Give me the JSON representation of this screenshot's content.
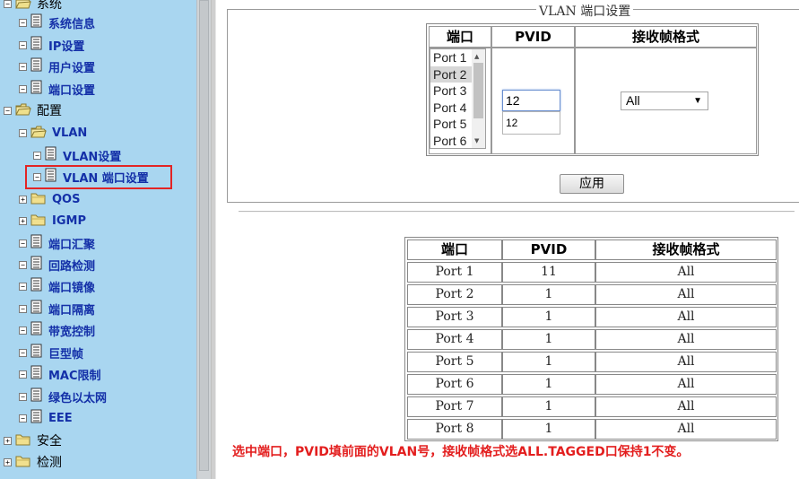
{
  "tree": {
    "items": [
      {
        "label": "系统",
        "level": 1,
        "toggle": "⊟",
        "icon": "open-folder-icon"
      },
      {
        "label": "系统信息",
        "level": 2,
        "toggle": "⊟",
        "icon": "document-icon"
      },
      {
        "label": "IP设置",
        "level": 2,
        "toggle": "⊟",
        "icon": "document-icon"
      },
      {
        "label": "用户设置",
        "level": 2,
        "toggle": "⊟",
        "icon": "document-icon"
      },
      {
        "label": "端口设置",
        "level": 2,
        "toggle": "⊟",
        "icon": "document-icon"
      },
      {
        "label": "配置",
        "level": 1,
        "toggle": "⊟",
        "icon": "open-folder-icon"
      },
      {
        "label": "VLAN",
        "level": 2,
        "toggle": "⊟",
        "icon": "open-folder-icon"
      },
      {
        "label": "VLAN设置",
        "level": 3,
        "toggle": "⊟",
        "icon": "document-icon"
      },
      {
        "label": "VLAN 端口设置",
        "level": 3,
        "toggle": "⊟",
        "icon": "document-icon",
        "selected": true
      },
      {
        "label": "QOS",
        "level": 2,
        "toggle": "⊞",
        "icon": "closed-folder-icon"
      },
      {
        "label": "IGMP",
        "level": 2,
        "toggle": "⊞",
        "icon": "closed-folder-icon"
      },
      {
        "label": "端口汇聚",
        "level": 2,
        "toggle": "⊟",
        "icon": "document-icon"
      },
      {
        "label": "回路检测",
        "level": 2,
        "toggle": "⊟",
        "icon": "document-icon"
      },
      {
        "label": "端口镜像",
        "level": 2,
        "toggle": "⊟",
        "icon": "document-icon"
      },
      {
        "label": "端口隔离",
        "level": 2,
        "toggle": "⊟",
        "icon": "document-icon"
      },
      {
        "label": "带宽控制",
        "level": 2,
        "toggle": "⊟",
        "icon": "document-icon"
      },
      {
        "label": "巨型帧",
        "level": 2,
        "toggle": "⊟",
        "icon": "document-icon"
      },
      {
        "label": "MAC限制",
        "level": 2,
        "toggle": "⊟",
        "icon": "document-icon"
      },
      {
        "label": "绿色以太网",
        "level": 2,
        "toggle": "⊟",
        "icon": "document-icon"
      },
      {
        "label": "EEE",
        "level": 2,
        "toggle": "⊟",
        "icon": "document-icon"
      },
      {
        "label": "安全",
        "level": 1,
        "toggle": "⊞",
        "icon": "closed-folder-icon"
      },
      {
        "label": "检测",
        "level": 1,
        "toggle": "⊞",
        "icon": "closed-folder-icon"
      }
    ]
  },
  "form": {
    "legend": "VLAN 端口设置",
    "headers": {
      "port": "端口",
      "pvid": "PVID",
      "format": "接收帧格式"
    },
    "ports": [
      "Port 1",
      "Port 2",
      "Port 3",
      "Port 4",
      "Port 5",
      "Port 6"
    ],
    "selected_port": "Port 2",
    "pvid_value": "12",
    "pvid_suggestion": "12",
    "format_value": "All",
    "apply_label": "应用"
  },
  "status_table": {
    "headers": [
      "端口",
      "PVID",
      "接收帧格式"
    ],
    "rows": [
      [
        "Port 1",
        "11",
        "All"
      ],
      [
        "Port 2",
        "1",
        "All"
      ],
      [
        "Port 3",
        "1",
        "All"
      ],
      [
        "Port 4",
        "1",
        "All"
      ],
      [
        "Port 5",
        "1",
        "All"
      ],
      [
        "Port 6",
        "1",
        "All"
      ],
      [
        "Port 7",
        "1",
        "All"
      ],
      [
        "Port 8",
        "1",
        "All"
      ]
    ]
  },
  "note": "选中端口，PVID填前面的VLAN号，接收帧格式选ALL.TAGGED口保持1不变。",
  "colors": {
    "tree_bg": "#a9d6f0",
    "tree_link": "#1430a8",
    "highlight_box": "#e32424",
    "note": "#e31e1e"
  }
}
